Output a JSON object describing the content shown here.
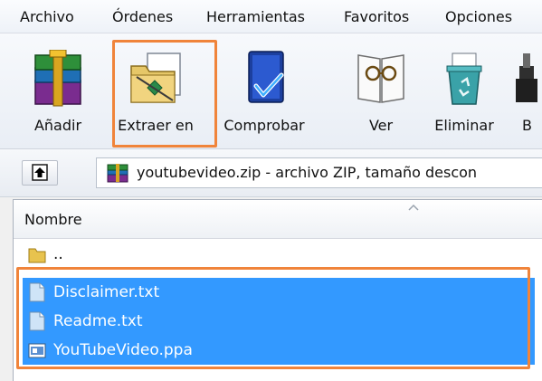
{
  "menu": {
    "items": [
      {
        "label": "Archivo"
      },
      {
        "label": "Órdenes"
      },
      {
        "label": "Herramientas"
      },
      {
        "label": "Favoritos"
      },
      {
        "label": "Opciones"
      }
    ]
  },
  "toolbar": {
    "buttons": [
      {
        "label": "Añadir",
        "icon": "archive-books-icon"
      },
      {
        "label": "Extraer en",
        "icon": "extract-folder-icon"
      },
      {
        "label": "Comprobar",
        "icon": "test-checkmark-icon"
      },
      {
        "label": "Ver",
        "icon": "view-glasses-icon"
      },
      {
        "label": "Eliminar",
        "icon": "delete-recycle-icon"
      },
      {
        "label": "B",
        "icon": "partial-tool-icon"
      }
    ],
    "highlighted": "Extraer en"
  },
  "address": {
    "path": "youtubevideo.zip - archivo ZIP, tamaño descon"
  },
  "filelist": {
    "column_header": "Nombre",
    "parent_entry": "..",
    "files": [
      {
        "name": "Disclaimer.txt",
        "selected": true,
        "icon": "text-file-icon"
      },
      {
        "name": "Readme.txt",
        "selected": true,
        "icon": "text-file-icon"
      },
      {
        "name": "YouTubeVideo.ppa",
        "selected": true,
        "icon": "ppa-file-icon"
      }
    ]
  },
  "colors": {
    "highlight": "#f0843a",
    "selection": "#3399ff"
  }
}
